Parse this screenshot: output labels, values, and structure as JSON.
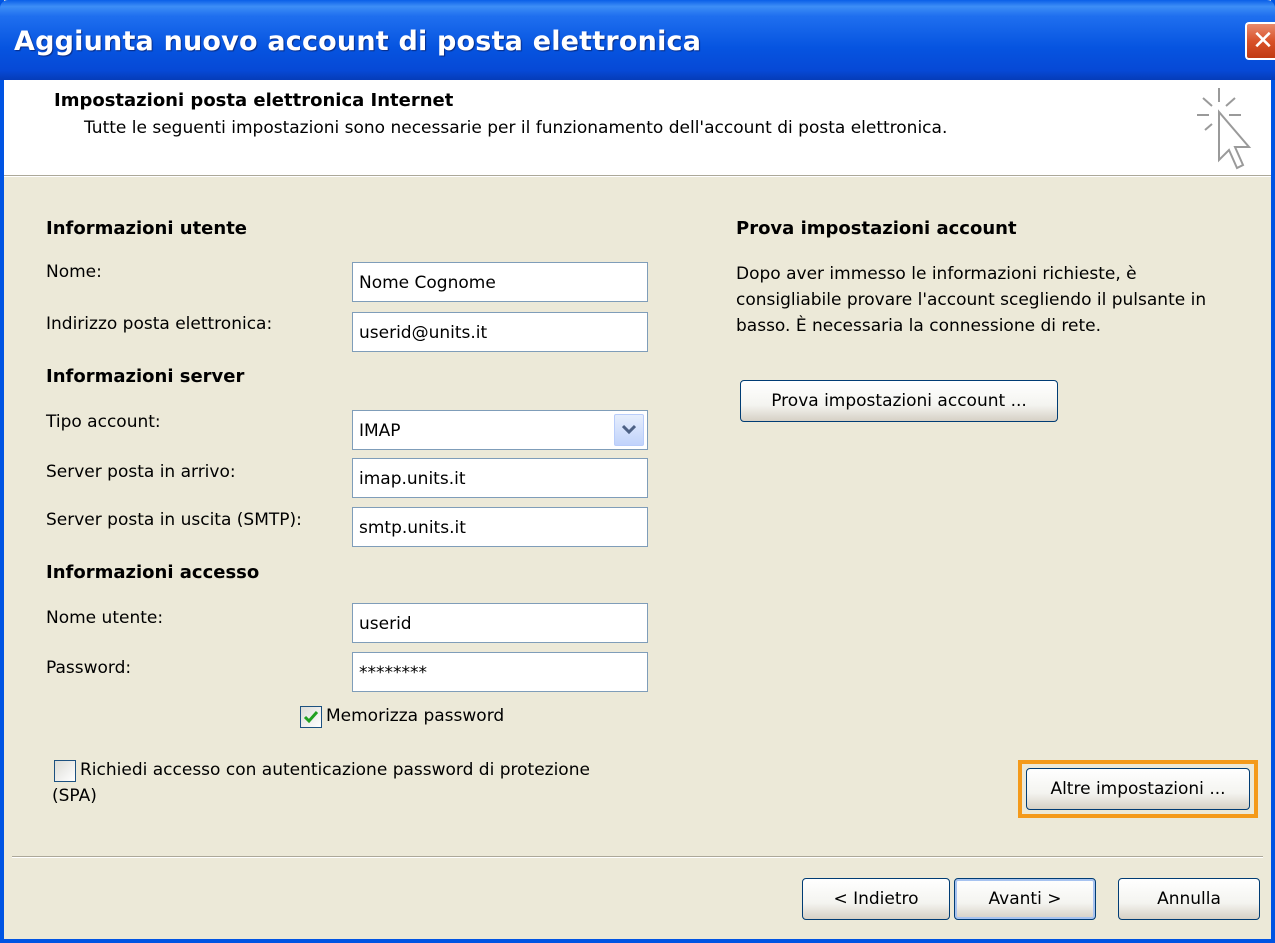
{
  "window": {
    "title": "Aggiunta nuovo account di posta elettronica",
    "close_glyph": "✕"
  },
  "header": {
    "title": "Impostazioni posta elettronica Internet",
    "subtitle": "Tutte le seguenti impostazioni sono necessarie per il funzionamento dell'account di posta elettronica.",
    "icon": "wizard-cursor-icon"
  },
  "user_info": {
    "heading": "Informazioni utente",
    "name_label": "Nome:",
    "name_value": "Nome Cognome",
    "email_label": "Indirizzo posta elettronica:",
    "email_value": "userid@units.it"
  },
  "server_info": {
    "heading": "Informazioni server",
    "account_type_label": "Tipo account:",
    "account_type_value": "IMAP",
    "incoming_label": "Server posta in arrivo:",
    "incoming_value": "imap.units.it",
    "outgoing_label": "Server posta in uscita (SMTP):",
    "outgoing_value": "smtp.units.it"
  },
  "login_info": {
    "heading": "Informazioni accesso",
    "username_label": "Nome utente:",
    "username_value": "userid",
    "password_label": "Password:",
    "password_value": "********",
    "remember_label": "Memorizza password",
    "remember_checked": true,
    "spa_label_line1": "Richiedi accesso con autenticazione password di protezione",
    "spa_label_line2": "(SPA)",
    "spa_checked": false
  },
  "test_panel": {
    "heading": "Prova impostazioni account",
    "description_line1": "Dopo aver immesso le informazioni richieste, è",
    "description_line2": "consigliabile provare l'account scegliendo il pulsante in",
    "description_line3": "basso. È necessaria la connessione di rete.",
    "test_button": "Prova impostazioni account ...",
    "more_settings_button": "Altre impostazioni ..."
  },
  "footer": {
    "back_button": "< Indietro",
    "next_button": "Avanti >",
    "cancel_button": "Annulla"
  },
  "colors": {
    "highlight": "#f49a1a",
    "titlebar": "#0654e0"
  }
}
